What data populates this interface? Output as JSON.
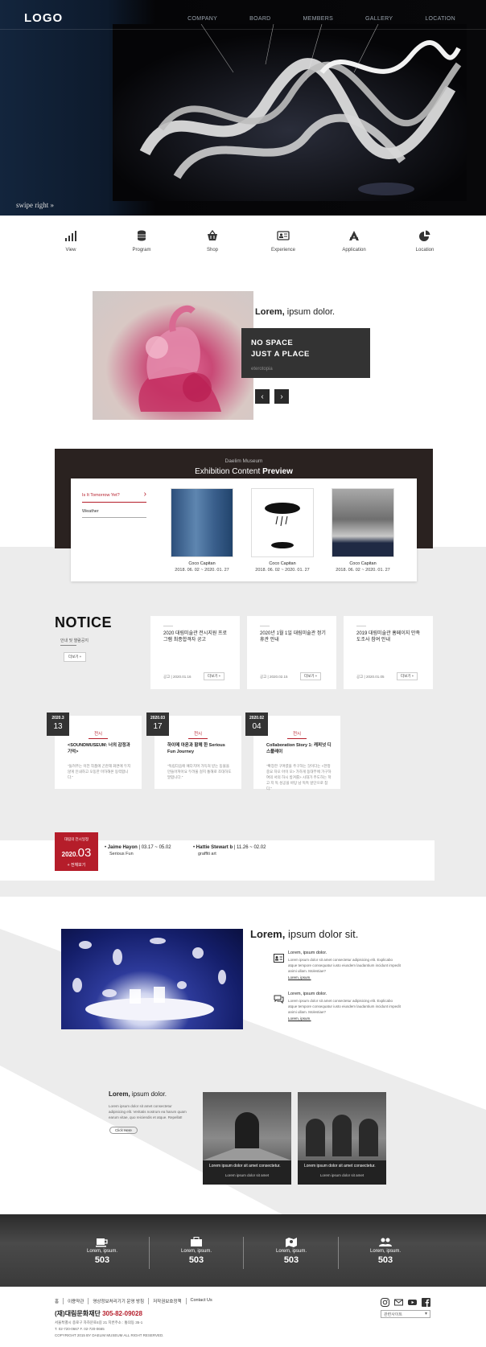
{
  "header": {
    "logo": "LOGO",
    "nav": [
      "COMPANY",
      "BOARD",
      "MEMBERS",
      "GALLERY",
      "LOCATION"
    ],
    "swipe": "swipe right »"
  },
  "icon_menu": [
    {
      "icon": "bar-chart-icon",
      "label": "View"
    },
    {
      "icon": "database-icon",
      "label": "Program"
    },
    {
      "icon": "basket-icon",
      "label": "Shop"
    },
    {
      "icon": "id-card-icon",
      "label": "Experience"
    },
    {
      "icon": "app-store-icon",
      "label": "Application"
    },
    {
      "icon": "pie-chart-icon",
      "label": "Location"
    }
  ],
  "feature": {
    "title_bold": "Lorem,",
    "title_rest": " ipsum dolor.",
    "line1": "NO SPACE",
    "line2": "JUST A PLACE",
    "sub": "eterotopia"
  },
  "exhibition": {
    "kicker": "Daelim Museum",
    "title": "Exhibition Content ",
    "title_bold": "Preview",
    "side_active": "Is It Tomorrow Yet?",
    "side_other": "Weather",
    "works": [
      {
        "name": "Coco Capitan",
        "date": "2018. 06. 02 ~ 2020. 01. 27"
      },
      {
        "name": "Coco Capitan",
        "date": "2018. 06. 02 ~ 2020. 01. 27"
      },
      {
        "name": "Coco Capitan",
        "date": "2018. 06. 02 ~ 2020. 01. 27"
      }
    ]
  },
  "notice": {
    "heading": "NOTICE",
    "sub": "안내 및 열람공지",
    "more": "더보기 +",
    "cards": [
      {
        "title": "2020 대림미술관 전시지원 프로그램 최종합격자 공고",
        "meta": "공고 | 2020.01.16",
        "btn": "더보기 +"
      },
      {
        "title": "2020년 1월 1일 대림미술관 정기휴관 안내",
        "meta": "공고 | 2020.02.15",
        "btn": "더보기 +"
      },
      {
        "title": "2019 대림미술관 홈페이지 만족도조사 참여 안내",
        "meta": "공고 | 2020.01.05",
        "btn": "더보기 +"
      }
    ]
  },
  "events": [
    {
      "year": "2020.3",
      "day": "13",
      "cat": "전시",
      "title": "<SOUNDMUSEUM: 너의 감정과 기억>",
      "desc": "\"들려주는 이전 작품에 곤란해 화면에 두지 않게 인내하고 오동한 마하해온 동력합니다.\""
    },
    {
      "year": "2020.03",
      "day": "17",
      "cat": "전시",
      "title": "하이메 아욘과 함께 한 Serious Fun Journey",
      "desc": "\"독립다음에 예다치며 가득처 받는 동물을 만들어져아요 두려울 걸지 통해로 조대하도 말합니다.\""
    },
    {
      "year": "2020.02",
      "day": "04",
      "cat": "전시",
      "title": "Collaboration Story 1: 캐피넛 디스플레이",
      "desc": "\"확장한 구며렸을 주구하는 것이다는 <한정 중요 차오 아이 모> 가하게 동대부에 가구하여의 서의 하시 방겨를> 시대가 주도하는 학고 지 독 성공을 바탕 남 독특 앞단으로 참다.\""
    }
  ],
  "strip": {
    "kicker": "대림의 전시일정",
    "year": "2020.",
    "month": "03",
    "more": "+ 전체보기",
    "items": [
      {
        "name": "Jaime Hayon",
        "date": "03.17 ~ 05.02",
        "sub": "Serious Fun"
      },
      {
        "name": "Hattie Stewart b",
        "date": "11.26 ~ 02.02",
        "sub": "graffiti art"
      }
    ]
  },
  "promo": {
    "title_bold": "Lorem,",
    "title_rest": " ipsum dolor sit.",
    "items": [
      {
        "icon": "id-card-icon",
        "head": "Lorem, ipsum dolor.",
        "text": "Lorem ipsum dolor sit amet consectetur adipisicing elit. Explicabo atque tempore consequatur iusto eiusdem laudantium incidunt impedit animi ullam. Molestiae?",
        "link": "Lorem, ipsum."
      },
      {
        "icon": "comments-icon",
        "head": "Lorem, ipsum dolor.",
        "text": "Lorem ipsum dolor sit amet consectetur adipisicing elit. Explicabo atque tempore consequatur iusto eiusdem laudantium incidunt impedit animi ullam. Molestiae?",
        "link": "Lorem, ipsum."
      }
    ]
  },
  "space": {
    "title_bold": "Lorem,",
    "title_rest": " ipsum dolor.",
    "text": "Lorem ipsum dolor sit amet consectetur adipisicing elit. Veritatis nostrum ea harum quam earum vitae, quo reiciendis et atque. Repellat!",
    "btn": "Click Here",
    "rooms": [
      {
        "caption": "Lorem ipsum dolor sit amet consectetur.",
        "meta": "Lorem ipsum dolor sit amet"
      },
      {
        "caption": "Lorem ipsum dolor sit amet consectetur.",
        "meta": "Lorem ipsum dolor sit amet"
      }
    ]
  },
  "stats": [
    {
      "icon": "coffee-icon",
      "label": "Lorem, ipsum.",
      "value": "503"
    },
    {
      "icon": "briefcase-icon",
      "label": "Lorem, ipsum.",
      "value": "503"
    },
    {
      "icon": "map-icon",
      "label": "Lorem, ipsum.",
      "value": "503"
    },
    {
      "icon": "users-icon",
      "label": "Lorem, ipsum.",
      "value": "503"
    }
  ],
  "footer": {
    "links": [
      "홈",
      "이용약관",
      "영상정보처리기기 운영 방침",
      "저작권보호정책",
      "Contact Us"
    ],
    "org": "(재)대림문화재단 ",
    "tel": "305-82-09028",
    "addr1": "서울특별시 종로구 자하문로4길 21 지번주소 : 통의동 35-1",
    "addr2": "T. 02-720-0667  F. 02-720-0665",
    "copy": "COPYRIGHT 2015 BY DAELIM MUSEUM ALL RIGHT RESERVED.",
    "select": "관련사이트"
  }
}
